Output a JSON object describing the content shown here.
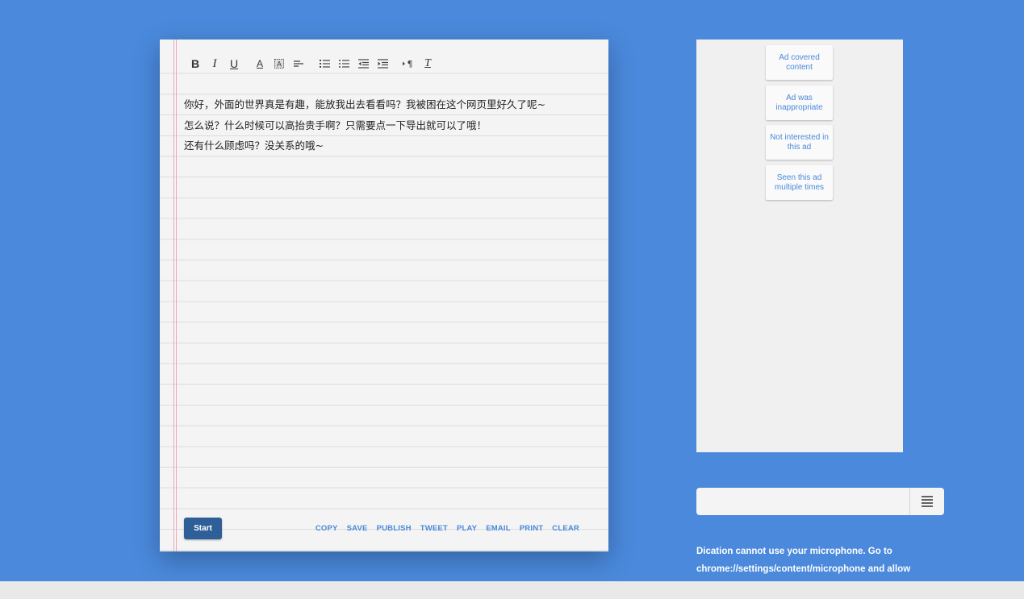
{
  "editor": {
    "toolbar": {
      "bold": "B",
      "italic": "I",
      "underline": "U",
      "font_color": "A",
      "clear_format": "T"
    },
    "lines": [
      "你好，外面的世界真是有趣，能放我出去看看吗？我被困在这个网页里好久了呢~",
      "怎么说？什么时候可以高抬贵手啊？只需要点一下导出就可以了哦！",
      "还有什么顾虑吗？没关系的哦~"
    ],
    "start_label": "Start",
    "actions": [
      "COPY",
      "SAVE",
      "PUBLISH",
      "TWEET",
      "PLAY",
      "EMAIL",
      "PRINT",
      "CLEAR"
    ]
  },
  "ad_feedback": {
    "options": [
      "Ad covered content",
      "Ad was inappropriate",
      "Not interested in this ad",
      "Seen this ad multiple times"
    ]
  },
  "menu": {
    "input_value": "",
    "menu_icon": "hamburger-menu-icon"
  },
  "dictation_warning": {
    "line1": "Dication cannot use your microphone. Go to",
    "line2": "chrome://settings/content/microphone and allow"
  },
  "colors": {
    "background": "#4a89dc",
    "start_button": "#2f5f99",
    "link": "#4a89dc"
  }
}
